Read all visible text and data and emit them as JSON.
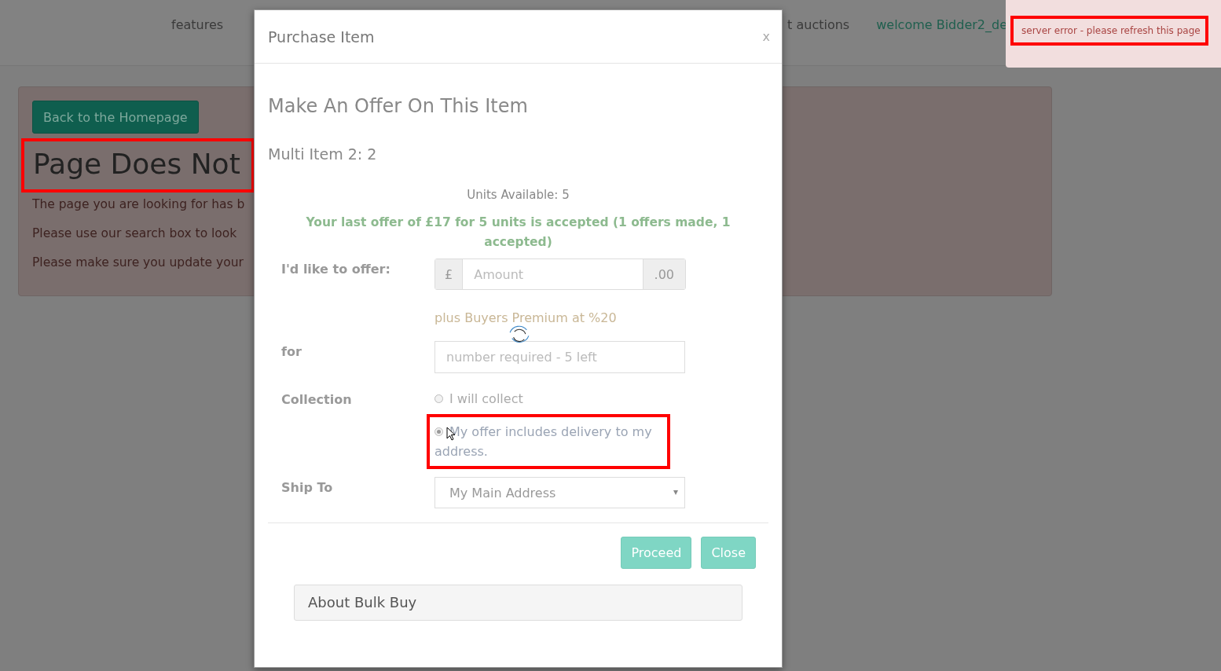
{
  "nav": {
    "links": [
      "features",
      "t auctions"
    ],
    "welcome": "welcome Bidder2_de"
  },
  "alert": {
    "message": "server error - please refresh this page",
    "highlighted": true
  },
  "page": {
    "button": "Back to the Homepage",
    "heading": "Page Does Not",
    "heading_highlighted": true,
    "paragraphs": [
      "The page you are looking for has b",
      "Please use our search box to look",
      "Please make sure you update your"
    ]
  },
  "modal": {
    "title": "Purchase Item",
    "close": "x",
    "loading": true,
    "heading": "Make An Offer On This Item",
    "item": "Multi Item 2: 2",
    "units": "Units Available: 5",
    "notice": "Your last offer of £17 for 5 units is accepted (1 offers made, 1 accepted)",
    "offer": {
      "label": "I'd like to offer:",
      "prefix": "£",
      "placeholder": "Amount",
      "suffix": ".00",
      "note": "plus Buyers Premium at %20"
    },
    "quantity": {
      "label": "for",
      "placeholder": "number required - 5 left"
    },
    "collection": {
      "label": "Collection",
      "options": [
        {
          "label": "I will collect",
          "selected": false,
          "highlighted": false
        },
        {
          "label": "My offer includes delivery to my address.",
          "selected": true,
          "highlighted": true
        }
      ]
    },
    "ship_to": {
      "label": "Ship To",
      "value": "My Main Address"
    },
    "buttons": [
      "Proceed",
      "Close"
    ],
    "panel": "About Bulk Buy"
  }
}
